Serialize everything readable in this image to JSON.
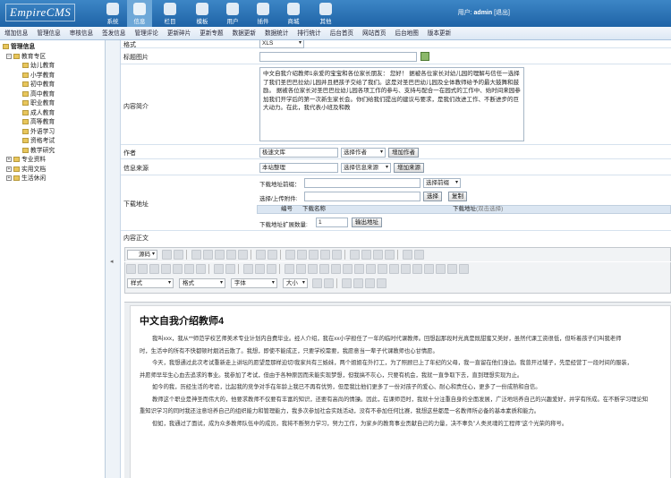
{
  "header": {
    "logo": "EmpireCMS",
    "nav": [
      {
        "label": "系统",
        "icon": "system-icon"
      },
      {
        "label": "信息",
        "icon": "info-icon"
      },
      {
        "label": "栏目",
        "icon": "column-icon"
      },
      {
        "label": "模板",
        "icon": "template-icon"
      },
      {
        "label": "用户",
        "icon": "user-icon"
      },
      {
        "label": "插件",
        "icon": "plugin-icon"
      },
      {
        "label": "商城",
        "icon": "shop-icon"
      },
      {
        "label": "其他",
        "icon": "other-icon"
      }
    ],
    "user_prefix": "用户:",
    "user_name": "admin",
    "logout": "[退出]"
  },
  "subnav": [
    "增加信息",
    "管理信息",
    "审核信息",
    "签发信息",
    "管理评论",
    "更新碎片",
    "更新专题",
    "数据更新",
    "数据统计",
    "排行统计",
    "后台首页",
    "网站首页",
    "后台地图",
    "版本更新"
  ],
  "sidebar": {
    "root": "管理信息",
    "group1": "教育专区",
    "items": [
      "幼儿教育",
      "小学教育",
      "初中教育",
      "高中教育",
      "职业教育",
      "成人教育",
      "高等教育",
      "外语学习",
      "资格考试",
      "教学研究"
    ],
    "others": [
      "专业资料",
      "实用文档",
      "生活休闲"
    ]
  },
  "form": {
    "format_label": "格式",
    "format_value": "XLS",
    "titlepic_label": "标题图片",
    "intro_label": "内容简介",
    "intro_text": "中文自我介绍教师1亲爱的宝宝和各位家长朋友：        您好！      据被各位家长对幼儿园的理解与信任一选择了我们圣巴巴拉幼儿园并且把孩子交给了我们。这是对圣巴巴幼儿园及全体教师给予的最大鼓舞和鼓励。      据被各位家长对圣巴巴拉幼儿园各项工作的参与、支持与配合一在园式的工作中、始时间来园参加我们开学后的第一次新生家长会。你们给我们提出的建议与要求，是我们改进工作、不断进步的巨大动力。在此，我代表小班及和教",
    "author_label": "作者",
    "author_value": "极速文库",
    "author_select": "选择作者",
    "author_add": "增加作者",
    "source_label": "信息来源",
    "source_value": "本站整理",
    "source_select": "选择信息来源",
    "source_add": "增加来源",
    "download_label": "下载地址",
    "dl_prefix_label": "下载地址前缀：",
    "dl_prefix_select": "选择前缀",
    "dl_upload_label": "选择/上传附件:",
    "dl_choose": "选择",
    "dl_copy": "复制",
    "dl_col_no": "编号",
    "dl_col_name": "下载名称",
    "dl_col_addr": "下载地址",
    "dl_col_hint": "(双击选择)",
    "dl_expand_label": "下载地址扩展数量:",
    "dl_expand_value": "1",
    "dl_output": "输出地址",
    "content_label": "内容正文"
  },
  "editor": {
    "source": "源码",
    "combos": [
      "样式",
      "格式",
      "字体",
      "大小"
    ],
    "title": "中文自我介绍教师4",
    "paragraphs": [
      "我叫xxx，我从**师范学校艺师美术专业计划内自费毕业。经人介绍，我在xx小学担任了一年的临时代课教师。回想起那段时光真是既甜蜜又美好，虽然代课工资很低，但听着孩子们叫我老师",
      "时，生活中的所有不快都顿时烟消云散了。我想，即使不能成正，只要学校需要，我愿意当一辈子代课教师也心甘情愿。",
      "今天，我想通过此次考试重新走上讲坛的愿望是那样迫切!我家共有三姊妹，两个姐姐在外打工，为了照顾已上了年纪的父母，我一直留在他们身边。我曾开过辅子，先是经营丁一段时间的服装，",
      "并愿师早毕生心血去追求的事业。我参加了考试，但由于各种原因而未能实现梦想，但我搞不灰心，只要有机会，我就一直争取下去，直到理想实现为止。",
      "如今的我，历经生活的考验，比起我的竞争对手在年龄上我已不再有优势，但是我比他们更多了一份对孩子的爱心、耐心和责任心，更多了一份成熟和自信。",
      "教师这个职业是神圣而伟大的，他要求教师不仅要有丰富的知识，还要有高尚的情操。因此，在课师范时，我就十分注重自身的全面发展，广泛地培养自己的兴趣爱好，并学有所成。在不断学习理论知",
      "重知识学习的同时我还注意培养自己的组织能力和管理能力，我多次参加社会实践活动，没有不参加任何比赛，我想这些都是一名教师所必备的基本素质和能力。",
      "但如，我通过了面试，成为众多教师队伍中的成员，我将不断努力学习，努力工作，为家乡的教育事业贡献自己的力量，决不辜负\"人类灵魂的工程师\"这个光荣的称号。"
    ]
  },
  "colors": {
    "header": "#2a6fb3",
    "accent": "#3d86c6"
  }
}
